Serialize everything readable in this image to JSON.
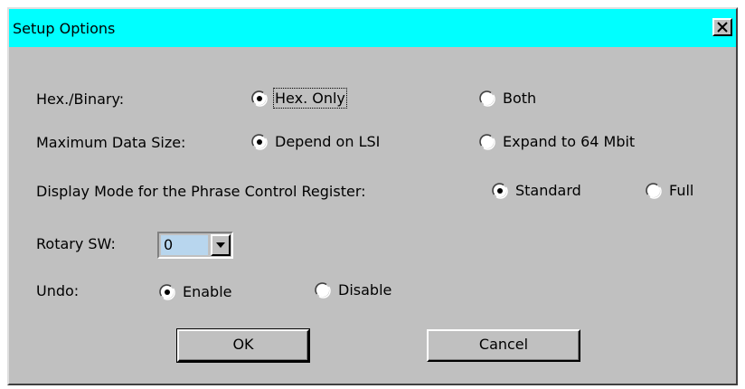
{
  "window": {
    "title": "Setup Options",
    "close_glyph": "✕"
  },
  "hex_binary": {
    "label": "Hex./Binary:",
    "options": [
      {
        "label": "Hex. Only",
        "selected": true,
        "focused": true
      },
      {
        "label": "Both",
        "selected": false
      }
    ]
  },
  "max_data_size": {
    "label": "Maximum Data Size:",
    "options": [
      {
        "label": "Depend on LSI",
        "selected": true
      },
      {
        "label": "Expand to 64 Mbit",
        "selected": false
      }
    ]
  },
  "display_mode": {
    "label": "Display Mode for the Phrase Control Register:",
    "options": [
      {
        "label": "Standard",
        "selected": true
      },
      {
        "label": "Full",
        "selected": false
      }
    ]
  },
  "rotary_sw": {
    "label": "Rotary SW:",
    "value": "0"
  },
  "undo": {
    "label": "Undo:",
    "options": [
      {
        "label": "Enable",
        "selected": true
      },
      {
        "label": "Disable",
        "selected": false
      }
    ]
  },
  "buttons": {
    "ok": "OK",
    "cancel": "Cancel"
  },
  "colors": {
    "titlebar": "#00ffff",
    "dialog_bg": "#c0c0c0",
    "combo_highlight": "#b8d6ee"
  }
}
